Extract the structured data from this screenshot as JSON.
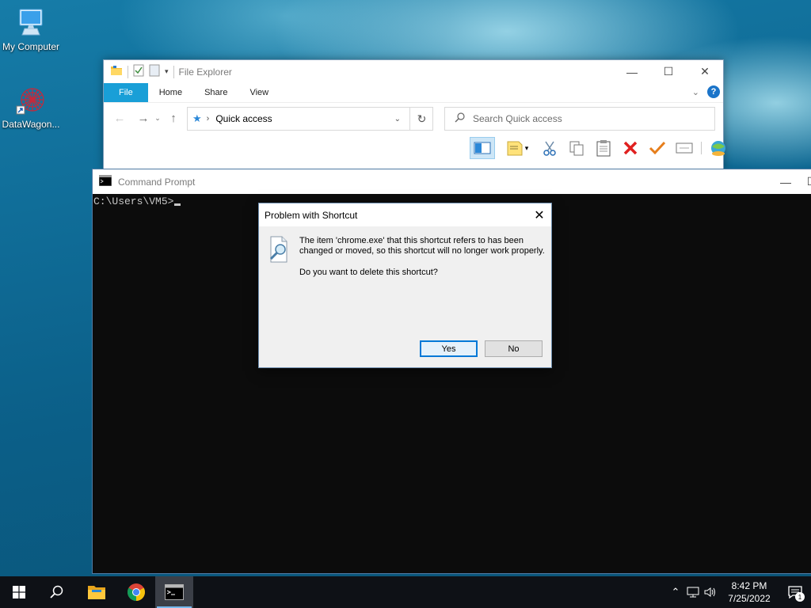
{
  "desktop": {
    "icons": [
      {
        "label": "My Computer",
        "icon": "monitor-icon"
      },
      {
        "label": "DataWagon...",
        "icon": "datawagon-shortcut-icon"
      }
    ]
  },
  "explorer": {
    "title": "File Explorer",
    "tabs": [
      "File",
      "Home",
      "Share",
      "View"
    ],
    "address": {
      "location": "Quick access"
    },
    "search": {
      "placeholder": "Search Quick access"
    },
    "window_controls": {
      "minimize": "—",
      "maximize": "☐",
      "close": "✕"
    }
  },
  "cmd": {
    "title": "Command Prompt",
    "prompt": "C:\\Users\\VM5>"
  },
  "dialog": {
    "title": "Problem with Shortcut",
    "message_line1": "The item 'chrome.exe' that this shortcut refers to has been changed or moved, so this shortcut will no longer work properly.",
    "message_line2": "Do you want to delete this shortcut?",
    "yes_label": "Yes",
    "no_label": "No",
    "close_glyph": "✕"
  },
  "taskbar": {
    "pinned": [
      "start-icon",
      "search-icon",
      "file-explorer-icon",
      "chrome-icon",
      "command-prompt-icon"
    ],
    "clock": {
      "time": "8:42 PM",
      "date": "7/25/2022"
    },
    "notification_count": "1"
  },
  "colors": {
    "accent": "#199fd7",
    "taskbar": "#0e1116",
    "dialog_bg": "#f0f0f0",
    "console_bg": "#0c0c0c"
  }
}
